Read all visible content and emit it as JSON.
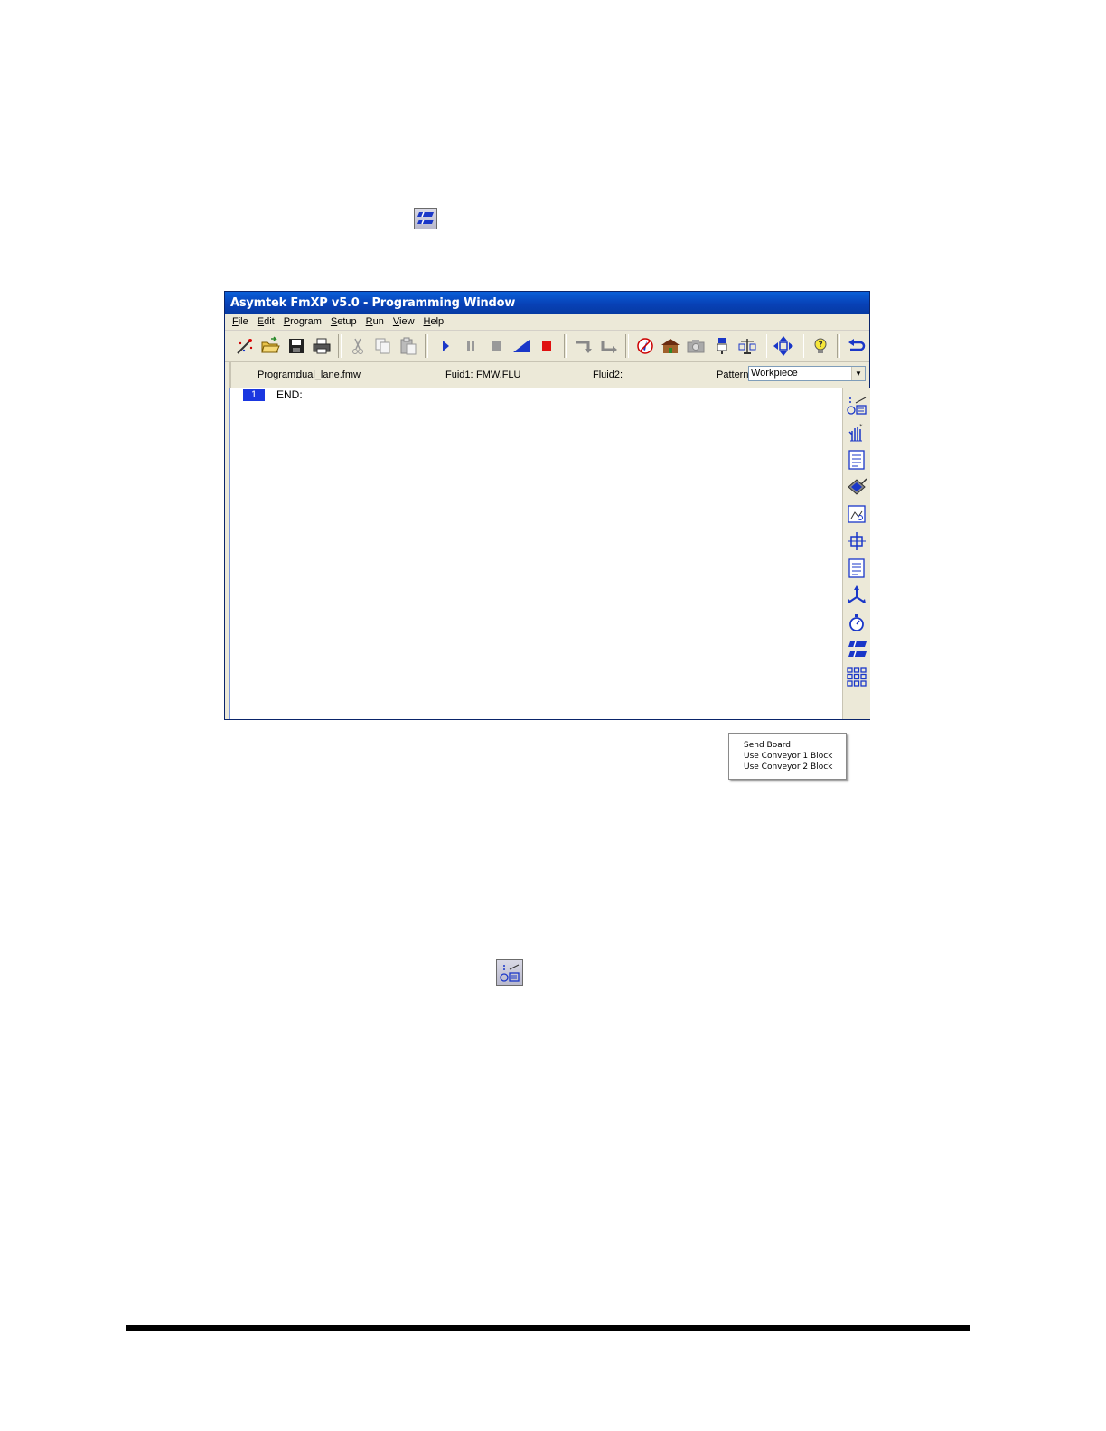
{
  "window": {
    "title": "Asymtek FmXP v5.0 - Programming Window"
  },
  "menubar": {
    "items": [
      "File",
      "Edit",
      "Program",
      "Setup",
      "Run",
      "View",
      "Help"
    ]
  },
  "toolbar": {
    "buttons": [
      "wizard-icon",
      "open-folder-icon",
      "save-icon",
      "print-icon",
      "cut-icon",
      "copy-icon",
      "paste-icon",
      "play-icon",
      "pause-icon",
      "stop-icon",
      "step-icon",
      "abort-icon",
      "step-in-icon",
      "step-out-icon",
      "needle-icon",
      "home-icon",
      "camera-icon",
      "dispense-head-icon",
      "scale-icon",
      "move-arrows-icon",
      "lightbulb-help-icon",
      "undo-icon"
    ]
  },
  "infobar": {
    "program_label": "Program:",
    "program_value": "dual_lane.fmw",
    "fluid1_label": "Fuid1:",
    "fluid1_value": "FMW.FLU",
    "fluid2_label": "Fluid2:",
    "pattern_label": "Pattern:",
    "pattern_value": "Workpiece"
  },
  "editor": {
    "lines": [
      {
        "number": "1",
        "code": "END:"
      }
    ]
  },
  "side_toolbar": {
    "buttons": [
      "send-board-icon",
      "hand-icon",
      "document-icon",
      "dispense-icon",
      "fiducial-icon",
      "align-icon",
      "notes-icon",
      "move-axes-icon",
      "timer-icon",
      "conveyor-icon",
      "array-grid-icon"
    ]
  },
  "context_menu": {
    "items": [
      "Send Board",
      "Use Conveyor 1 Block",
      "Use Conveyor 2 Block"
    ]
  },
  "colors": {
    "titlebar": "#0841b6",
    "line_highlight": "#1a37e0",
    "icon_blue": "#1a37c8"
  }
}
